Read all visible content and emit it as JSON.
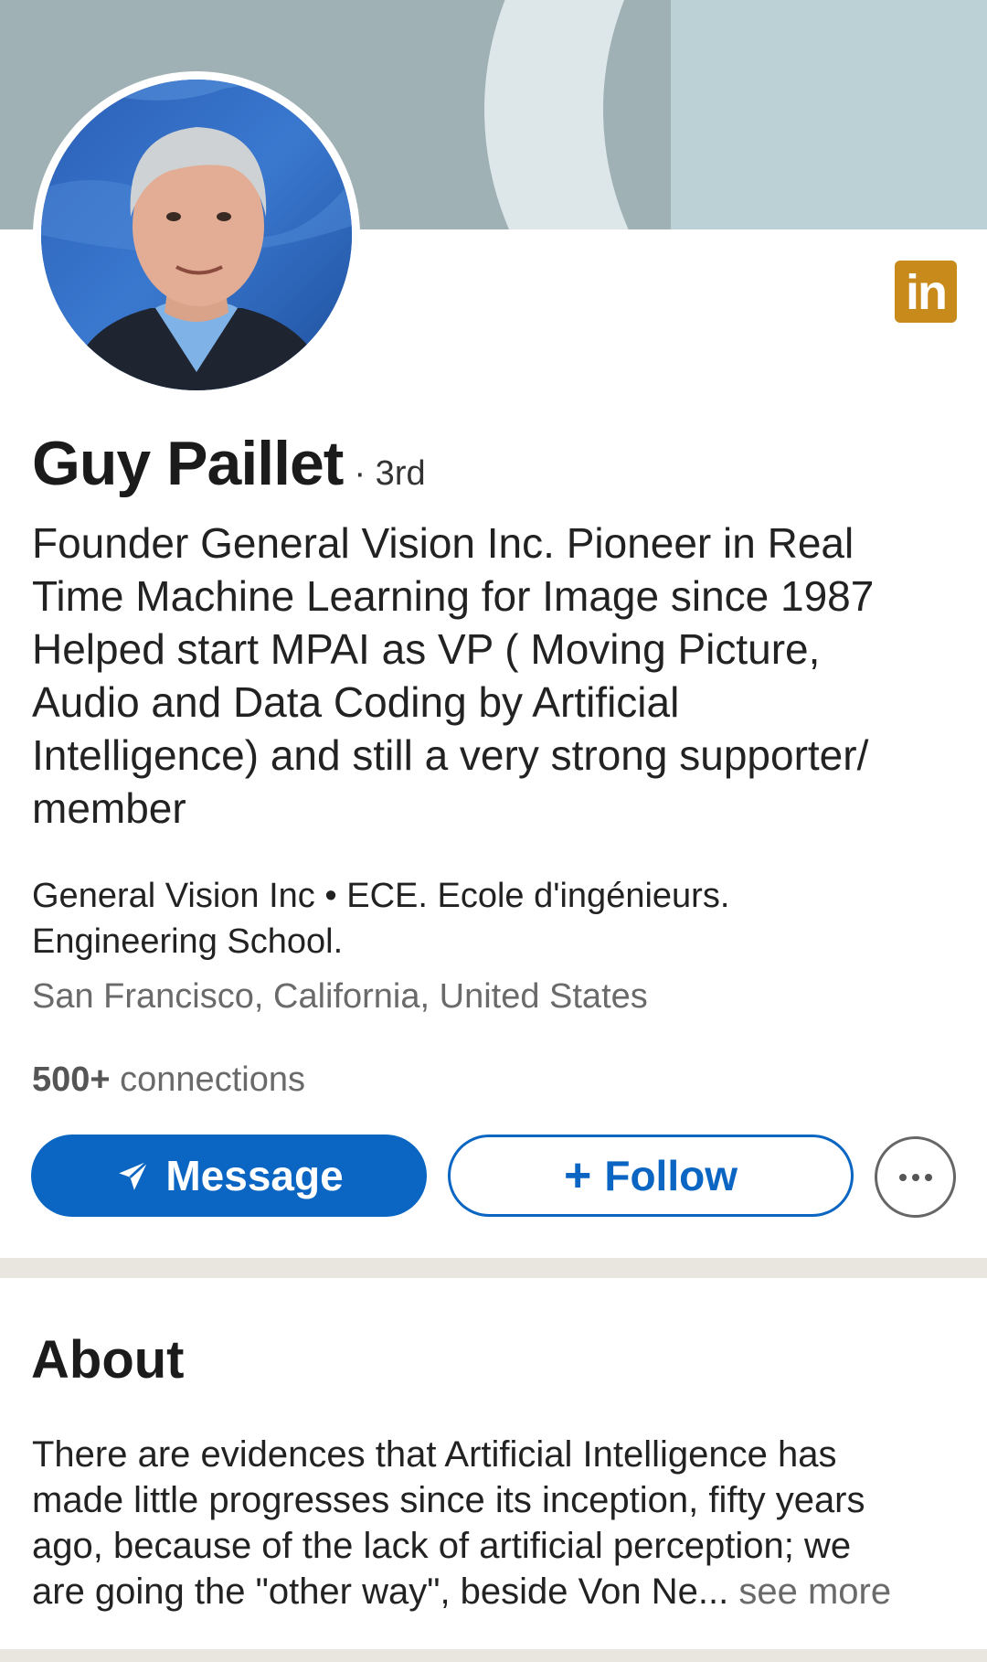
{
  "profile": {
    "name": "Guy Paillet",
    "degree": "· 3rd",
    "headline_lines": [
      "Founder General Vision Inc. Pioneer in Real",
      "Time Machine Learning for Image since 1987",
      "Helped start MPAI as VP ( Moving Picture,",
      "Audio and Data Coding by Artificial",
      "Intelligence) and still a very strong supporter/",
      "member"
    ],
    "meta_lines": [
      "General Vision Inc • ECE. Ecole d'ingénieurs.",
      "Engineering School."
    ],
    "location": "San Francisco, California, United States",
    "connections_count": "500+",
    "connections_label": "connections"
  },
  "logo": {
    "text": "in",
    "color": "#c88a1a"
  },
  "actions": {
    "message_label": "Message",
    "follow_label": "Follow",
    "follow_prefix": "+",
    "more_icon": "ellipsis-icon"
  },
  "about": {
    "title": "About",
    "lines": [
      "There are evidences that Artificial Intelligence has",
      "made little progresses since its inception, fifty years",
      "ago, because of the lack of artificial perception; we"
    ],
    "last_line": "are going the \"other way\", beside Von Ne...",
    "see_more": "see more"
  },
  "colors": {
    "primary": "#0a66c2",
    "banner": "#9fb1b5",
    "divider": "#e9e6e0"
  }
}
